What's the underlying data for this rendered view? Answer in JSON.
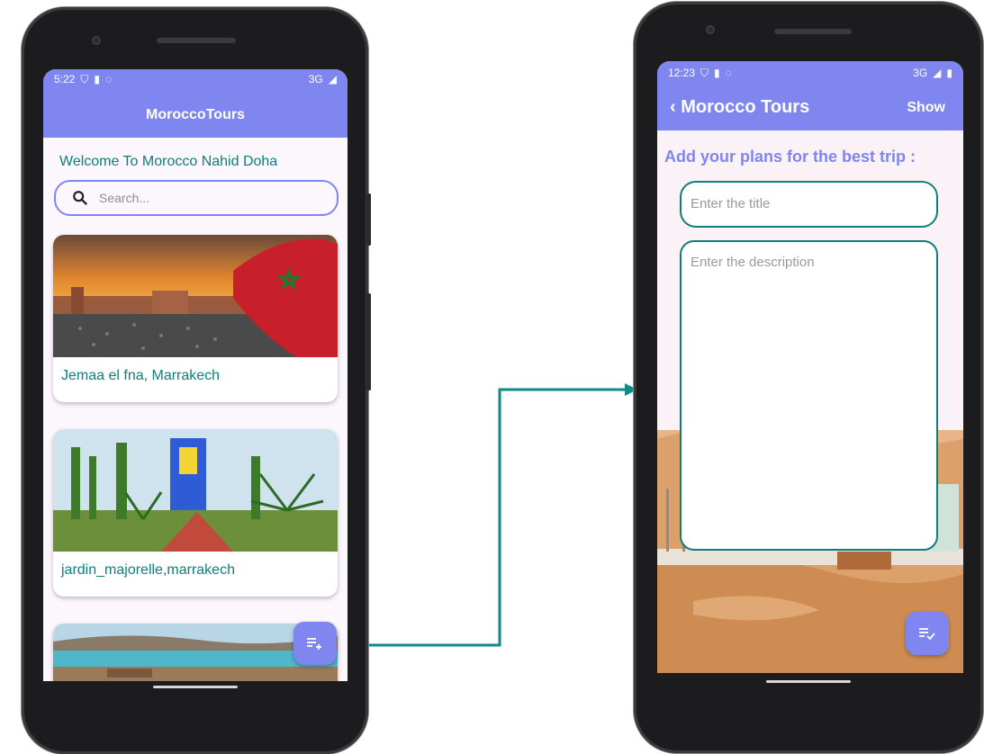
{
  "left_screen": {
    "status": {
      "time": "5:22",
      "network": "3G"
    },
    "app_title": "MoroccoTours",
    "welcome": "Welcome To Morocco Nahid Doha",
    "search_placeholder": "Search...",
    "places": [
      {
        "label": "Jemaa el fna, Marrakech"
      },
      {
        "label": "jardin_majorelle,marrakech"
      },
      {
        "label": ""
      }
    ],
    "fab_icon": "playlist-add-icon"
  },
  "right_screen": {
    "status": {
      "time": "12:23",
      "network": "3G"
    },
    "back_title": "Morocco Tours",
    "show_label": "Show",
    "heading": "Add your plans for the best trip :",
    "title_placeholder": "Enter the title",
    "description_placeholder": "Enter the description",
    "fab_icon": "playlist-check-icon"
  },
  "colors": {
    "accent": "#7f86f0",
    "teal": "#0e7f7b",
    "desert": "#d9a06a"
  }
}
